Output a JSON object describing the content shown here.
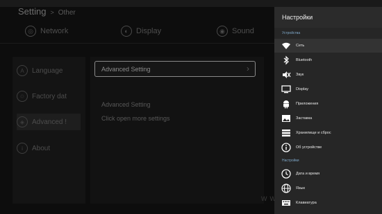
{
  "app": {
    "title": "Setting",
    "separator": ">",
    "subtitle": "Other"
  },
  "top_tabs": [
    {
      "label": "Network",
      "icon": "globe-icon"
    },
    {
      "label": "Display",
      "icon": "display-icon"
    },
    {
      "label": "Sound",
      "icon": "sound-icon"
    }
  ],
  "left_menu": [
    {
      "label": "Language",
      "icon": "language-icon"
    },
    {
      "label": "Factory dat",
      "icon": "factory-icon"
    },
    {
      "label": "Advanced !",
      "icon": "advanced-icon",
      "active": true
    },
    {
      "label": "About",
      "icon": "info-icon"
    }
  ],
  "main": {
    "row_label": "Advanced Setting",
    "desc_title": "Advanced Setting",
    "desc_body": "Click open more settings"
  },
  "watermark": "WWW",
  "drawer": {
    "title": "Настройки",
    "section_device": "Устройства",
    "section_settings": "Настройки",
    "items": [
      {
        "label": "Сеть",
        "icon": "wifi-icon",
        "selected": true
      },
      {
        "label": "Bluetooth",
        "icon": "bluetooth-icon"
      },
      {
        "label": "Звук",
        "icon": "sound-off-icon"
      },
      {
        "label": "Display",
        "icon": "monitor-icon"
      },
      {
        "label": "Приложения",
        "icon": "android-icon"
      },
      {
        "label": "Заставка",
        "icon": "screensaver-icon"
      },
      {
        "label": "Хранилище и сброс",
        "icon": "storage-icon"
      },
      {
        "label": "Об устройстве",
        "icon": "info-icon"
      },
      {
        "label": "Дата и время",
        "icon": "clock-icon"
      },
      {
        "label": "Язык",
        "icon": "globe-icon"
      },
      {
        "label": "Клавиатура",
        "icon": "keyboard-icon"
      }
    ]
  },
  "colors": {
    "background": "#0d0d0d",
    "drawer": "#262626",
    "section_accent": "#7fa8c9"
  }
}
